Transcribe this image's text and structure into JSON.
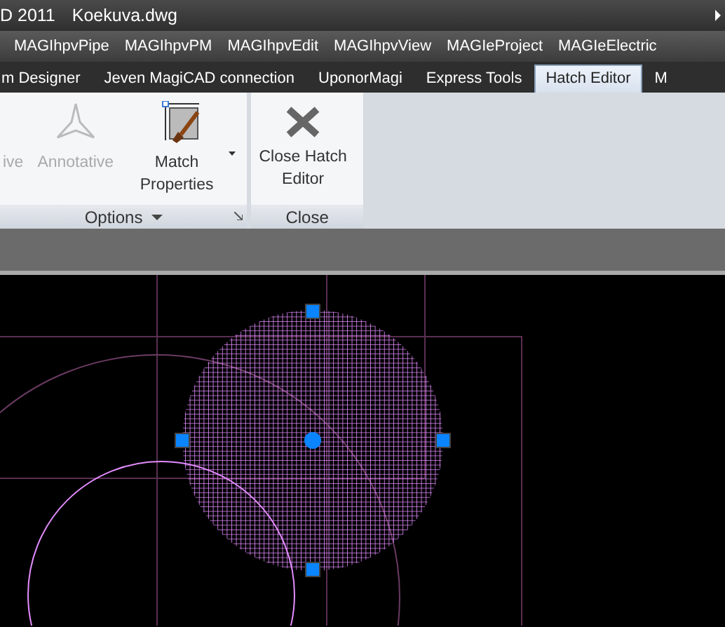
{
  "title_bar": {
    "app": "D 2011",
    "file": "Koekuva.dwg"
  },
  "menu": [
    "MAGIhpvPipe",
    "MAGIhpvPM",
    "MAGIhpvEdit",
    "MAGIhpvView",
    "MAGIeProject",
    "MAGIeElectric"
  ],
  "tabs": [
    {
      "label": "m Designer",
      "selected": false
    },
    {
      "label": "Jeven MagiCAD connection",
      "selected": false
    },
    {
      "label": "UponorMagi",
      "selected": false
    },
    {
      "label": "Express Tools",
      "selected": false
    },
    {
      "label": "Hatch Editor",
      "selected": true
    },
    {
      "label": "M",
      "selected": false
    }
  ],
  "ribbon": {
    "panels": [
      {
        "title": "Options",
        "menu": true,
        "launcher": true,
        "items": [
          {
            "kind": "cut",
            "label": "ive",
            "disabled": true
          },
          {
            "kind": "annotative",
            "label": "Annotative",
            "disabled": true
          },
          {
            "kind": "match",
            "label": "Match Properties",
            "disabled": false,
            "dropdown": true
          }
        ]
      },
      {
        "title": "Close",
        "menu": false,
        "launcher": false,
        "items": [
          {
            "kind": "close",
            "label": "Close Hatch Editor",
            "disabled": false
          }
        ]
      }
    ]
  }
}
